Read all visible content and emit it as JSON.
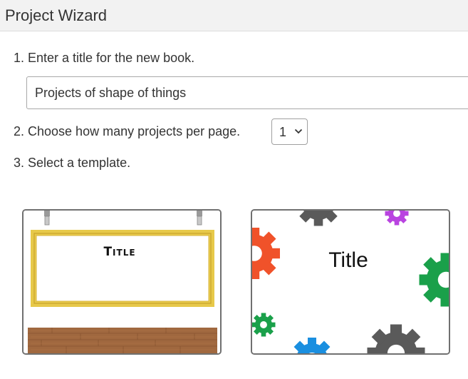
{
  "header": {
    "title": "Project Wizard"
  },
  "steps": {
    "step1": "1. Enter a title for the new book.",
    "step2": "2. Choose how many projects per page.",
    "step3": "3. Select a template."
  },
  "book_title": {
    "value": "Projects of shape of things"
  },
  "projects_per_page": {
    "selected": "1",
    "icon": "chevron-down-icon"
  },
  "templates": [
    {
      "name": "Hanging sign",
      "title_text": "Title"
    },
    {
      "name": "Gears",
      "title_text": "Title"
    }
  ],
  "colors": {
    "frame_gold": "#e7c94a",
    "floor_wood": "#a0683f",
    "gear_red": "#f0522a",
    "gear_green": "#1aa04a",
    "gear_blue": "#1a8fe0",
    "gear_purple": "#b944e0",
    "gear_gray": "#5a5a5a"
  }
}
